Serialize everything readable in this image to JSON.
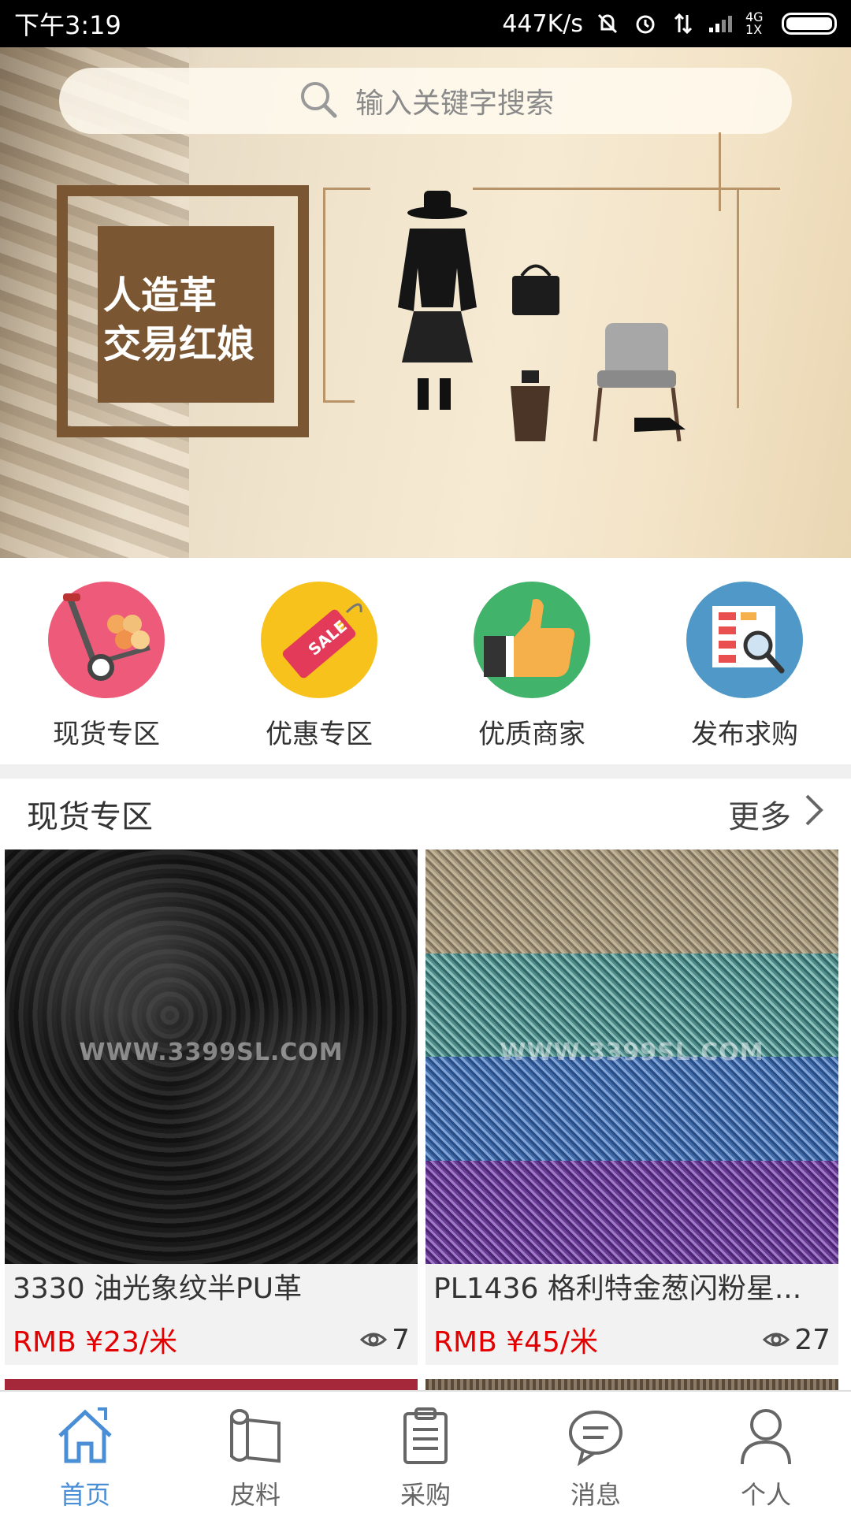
{
  "status_bar": {
    "time": "下午3:19",
    "speed": "447K/s",
    "network": "4G 1X"
  },
  "search": {
    "placeholder": "输入关键字搜索"
  },
  "banner": {
    "logo_line1": "人造革",
    "logo_line2": "交易红娘"
  },
  "categories": [
    {
      "label": "现货专区",
      "icon": "cart-spools-icon",
      "color": "#ee5b7a"
    },
    {
      "label": "优惠专区",
      "icon": "sale-tag-icon",
      "color": "#f7c21b"
    },
    {
      "label": "优质商家",
      "icon": "thumbs-up-icon",
      "color": "#41b36b"
    },
    {
      "label": "发布求购",
      "icon": "search-list-icon",
      "color": "#4f98c7"
    }
  ],
  "section": {
    "title": "现货专区",
    "more": "更多"
  },
  "products": [
    {
      "name": "3330 油光象纹半PU革",
      "price": "RMB ¥23/米",
      "views": "7",
      "watermark": "WWW.3399SL.COM"
    },
    {
      "name": "PL1436 格利特金葱闪粉星...",
      "price": "RMB ¥45/米",
      "views": "27",
      "watermark": "WWW.3399SL.COM"
    }
  ],
  "tabs": [
    {
      "label": "首页",
      "icon": "home-icon",
      "active": true
    },
    {
      "label": "皮料",
      "icon": "material-roll-icon",
      "active": false
    },
    {
      "label": "采购",
      "icon": "clipboard-icon",
      "active": false
    },
    {
      "label": "消息",
      "icon": "message-icon",
      "active": false
    },
    {
      "label": "个人",
      "icon": "person-icon",
      "active": false
    }
  ],
  "colors": {
    "accent": "#4a8fd6",
    "price": "#e40000",
    "brand_brown": "#7a5632"
  }
}
